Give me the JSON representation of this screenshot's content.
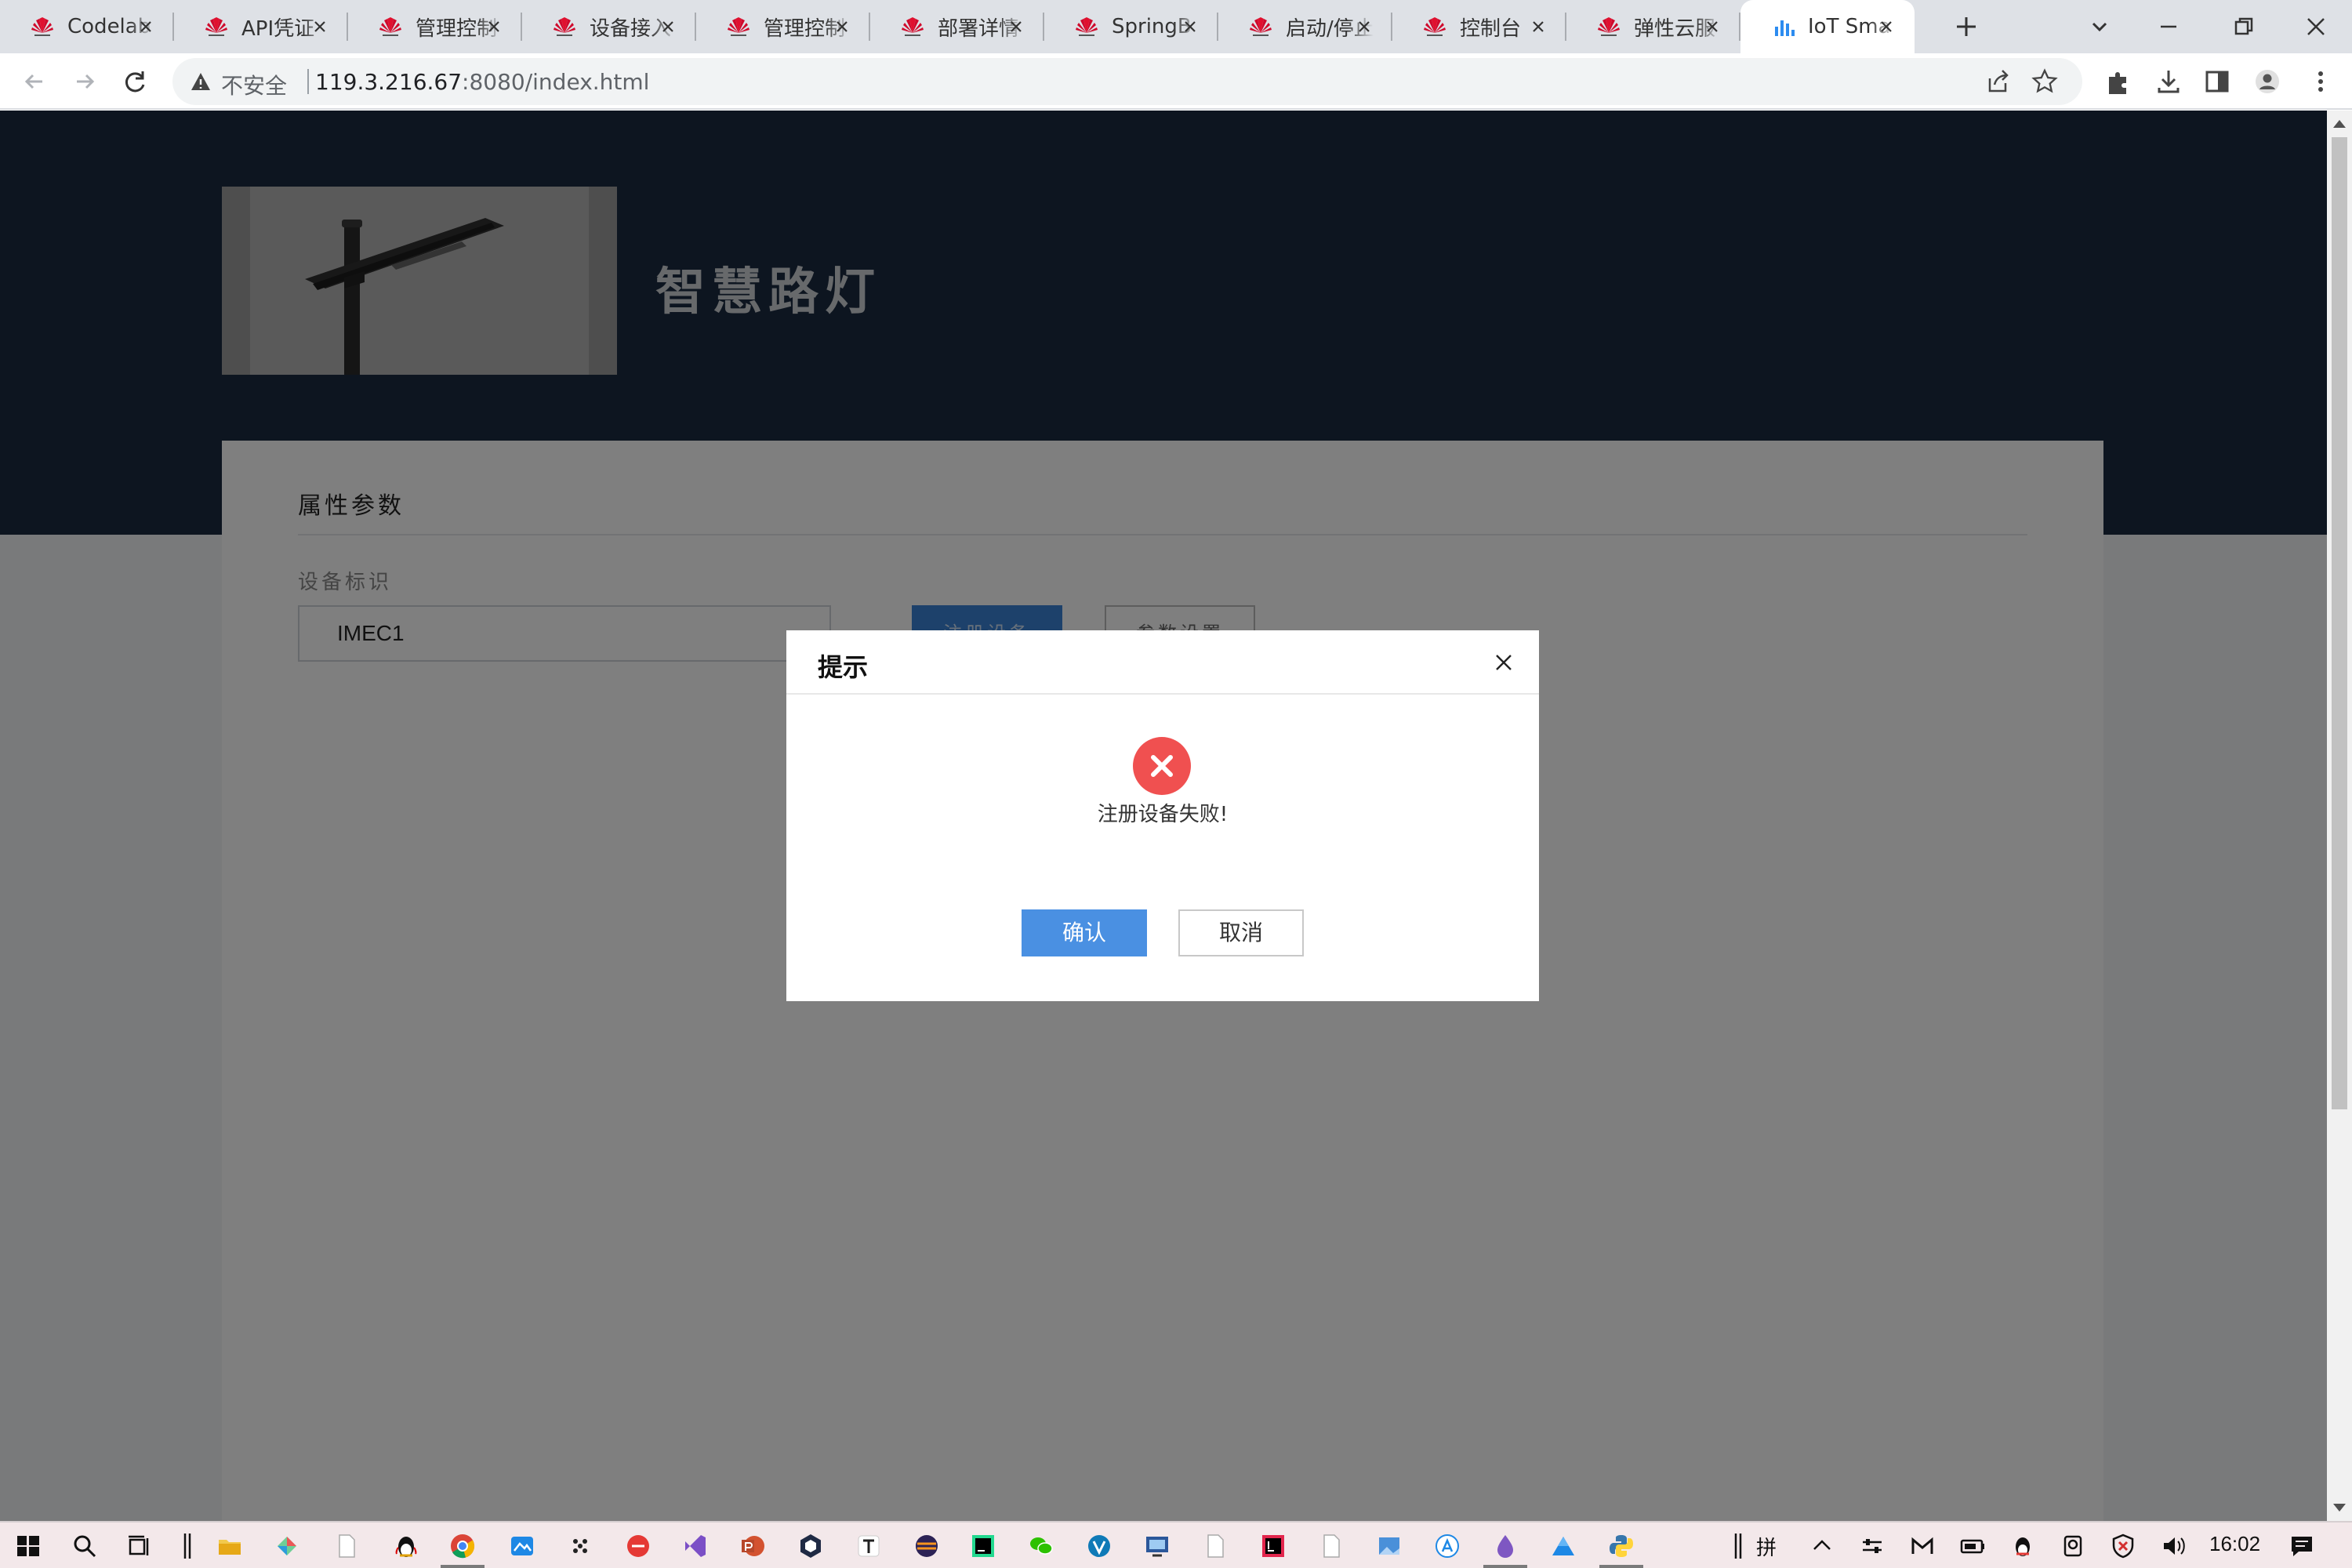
{
  "browser": {
    "tabs": [
      {
        "title": "Codelab",
        "favicon": "huawei-icon"
      },
      {
        "title": "API凭证",
        "favicon": "huawei-icon"
      },
      {
        "title": "管理控制",
        "favicon": "huawei-icon"
      },
      {
        "title": "设备接入",
        "favicon": "huawei-icon"
      },
      {
        "title": "管理控制",
        "favicon": "huawei-icon"
      },
      {
        "title": "部署详情",
        "favicon": "huawei-icon"
      },
      {
        "title": "SpringB",
        "favicon": "huawei-icon"
      },
      {
        "title": "启动/停止",
        "favicon": "huawei-icon"
      },
      {
        "title": "控制台",
        "favicon": "huawei-icon"
      },
      {
        "title": "弹性云服",
        "favicon": "huawei-icon"
      },
      {
        "title": "IoT Sma",
        "favicon": "bar-chart-icon",
        "active": true
      }
    ],
    "security_label": "不安全",
    "url_host": "119.3.216.67",
    "url_path": ":8080/index.html"
  },
  "page": {
    "hero_title": "智慧路灯",
    "panel_title": "属性参数",
    "device_id_label": "设备标识",
    "device_id_value": "IMEC1",
    "register_button": "注册设备",
    "params_button": "参数设置"
  },
  "dialog": {
    "title": "提示",
    "message": "注册设备失败!",
    "confirm_label": "确认",
    "cancel_label": "取消"
  },
  "taskbar": {
    "ime_label": "拼",
    "clock": "16:02"
  },
  "colors": {
    "hero_bg": "#1a2a40",
    "primary_button": "#4a90e2",
    "error_icon": "#f05050",
    "tab_strip": "#dee1e6"
  }
}
